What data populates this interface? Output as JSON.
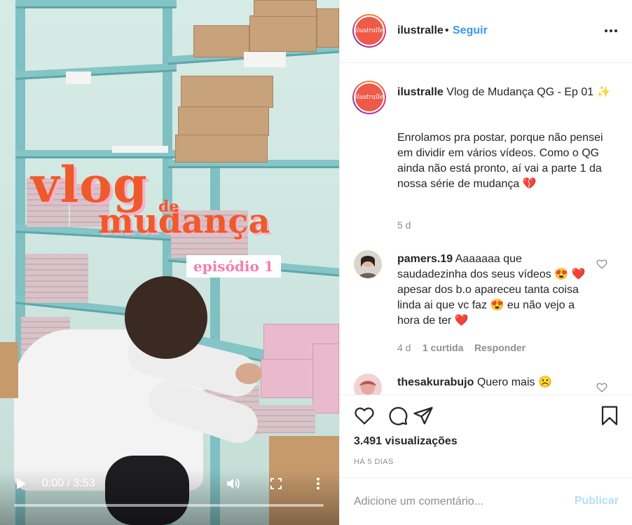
{
  "video": {
    "overlay_title_line1": "vlog",
    "overlay_title_de": "de",
    "overlay_title_line2": "mudança",
    "overlay_title_episode": "episódio 1",
    "time": "0:00 / 3:53",
    "progress": 0
  },
  "header": {
    "username": "ilustralle",
    "separator": "•",
    "follow_label": "Seguir",
    "more_icon": "more-horizontal-icon"
  },
  "caption": {
    "username": "ilustralle",
    "title": "Vlog de Mudança QG - Ep 01 ✨",
    "body": "Enrolamos pra postar, porque não pensei em dividir em vários vídeos. Como o QG ainda não está pronto, aí vai a parte 1 da nossa série de mudança 💔",
    "time": "5 d"
  },
  "comments": [
    {
      "username": "pamers.19",
      "text": "Aaaaaaa que saudadezinha dos seus vídeos 😍 ❤️ apesar dos b.o apareceu tanta coisa linda ai que vc faz 😍 eu não vejo a hora de ter ❤️",
      "time": "4 d",
      "likes": "1 curtida",
      "reply": "Responder"
    },
    {
      "username": "thesakurabujo",
      "text": "Quero mais ☹️"
    }
  ],
  "actions": {
    "views": "3.491 visualizações",
    "posted": "HÁ 5 DIAS"
  },
  "add_comment": {
    "placeholder": "Adicione um comentário...",
    "publish_label": "Publicar"
  },
  "colors": {
    "accent": "#3897f0",
    "publish_disabled": "#b2dffc",
    "muted": "#8e8e8e",
    "title_orange": "#ef5a2a",
    "title_pink": "#f6b2cc"
  }
}
